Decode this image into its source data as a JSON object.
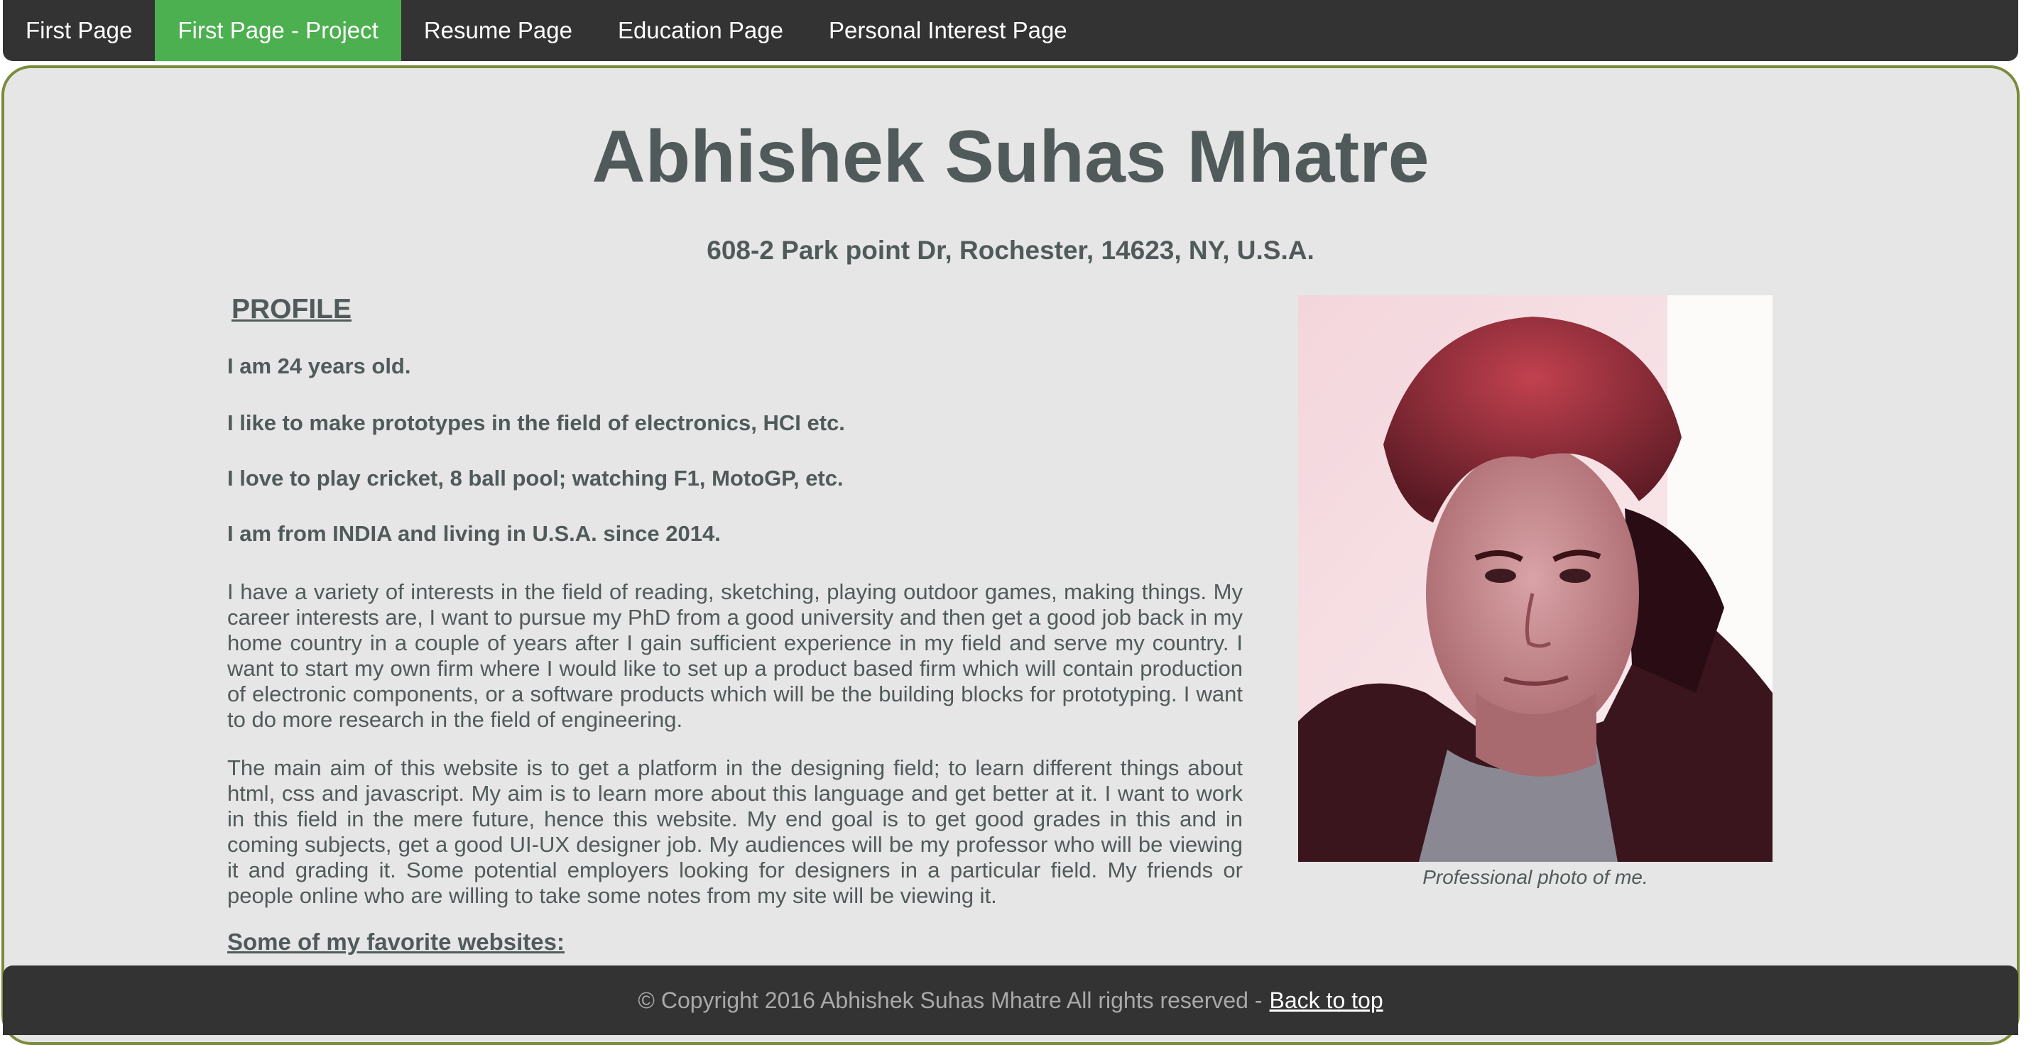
{
  "nav": {
    "items": [
      {
        "label": "First Page",
        "active": false
      },
      {
        "label": "First Page - Project",
        "active": true
      },
      {
        "label": "Resume Page",
        "active": false
      },
      {
        "label": "Education Page",
        "active": false
      },
      {
        "label": "Personal Interest Page",
        "active": false
      }
    ]
  },
  "header": {
    "title": "Abhishek Suhas Mhatre",
    "address": "608-2 Park point Dr, Rochester, 14623, NY, U.S.A."
  },
  "profile": {
    "heading": "PROFILE",
    "facts": [
      "I am 24 years old.",
      "I like to make prototypes in the field of electronics, HCI etc.",
      "I love to play cricket, 8 ball pool; watching F1, MotoGP, etc.",
      "I am from INDIA and living in U.S.A. since 2014."
    ],
    "paragraphs": [
      "I have a variety of interests in the field of reading, sketching, playing outdoor games, making things. My career interests are, I want to pursue my PhD from a good university and then get a good job back in my home country in a couple of years after I gain sufficient experience in my field and serve my country. I want to start my own firm where I would like to set up a product based firm which will contain production of electronic components, or a software products which will be the building blocks for prototyping. I want to do more research in the field of engineering.",
      "The main aim of this website is to get a platform in the designing field; to learn different things about html, css and javascript. My aim is to learn more about this language and get better at it. I want to work in this field in the mere future, hence this website. My end goal is to get good grades in this and in coming subjects, get a good UI-UX designer job. My audiences will be my professor who will be viewing it and grading it. Some potential employers looking for designers in a particular field. My friends or people online who are willing to take some notes from my site will be viewing it."
    ],
    "favorites_heading": "Some of my favorite websites:"
  },
  "photo": {
    "caption": "Professional photo of me."
  },
  "footer": {
    "copyright": "© Copyright 2016 Abhishek Suhas Mhatre All rights reserved -",
    "back_to_top": "Back to top"
  },
  "colors": {
    "nav_bg": "#333333",
    "nav_active": "#4caf50",
    "page_bg": "#e6e6e6",
    "border": "#7a8c3c",
    "text": "#515a5a"
  }
}
